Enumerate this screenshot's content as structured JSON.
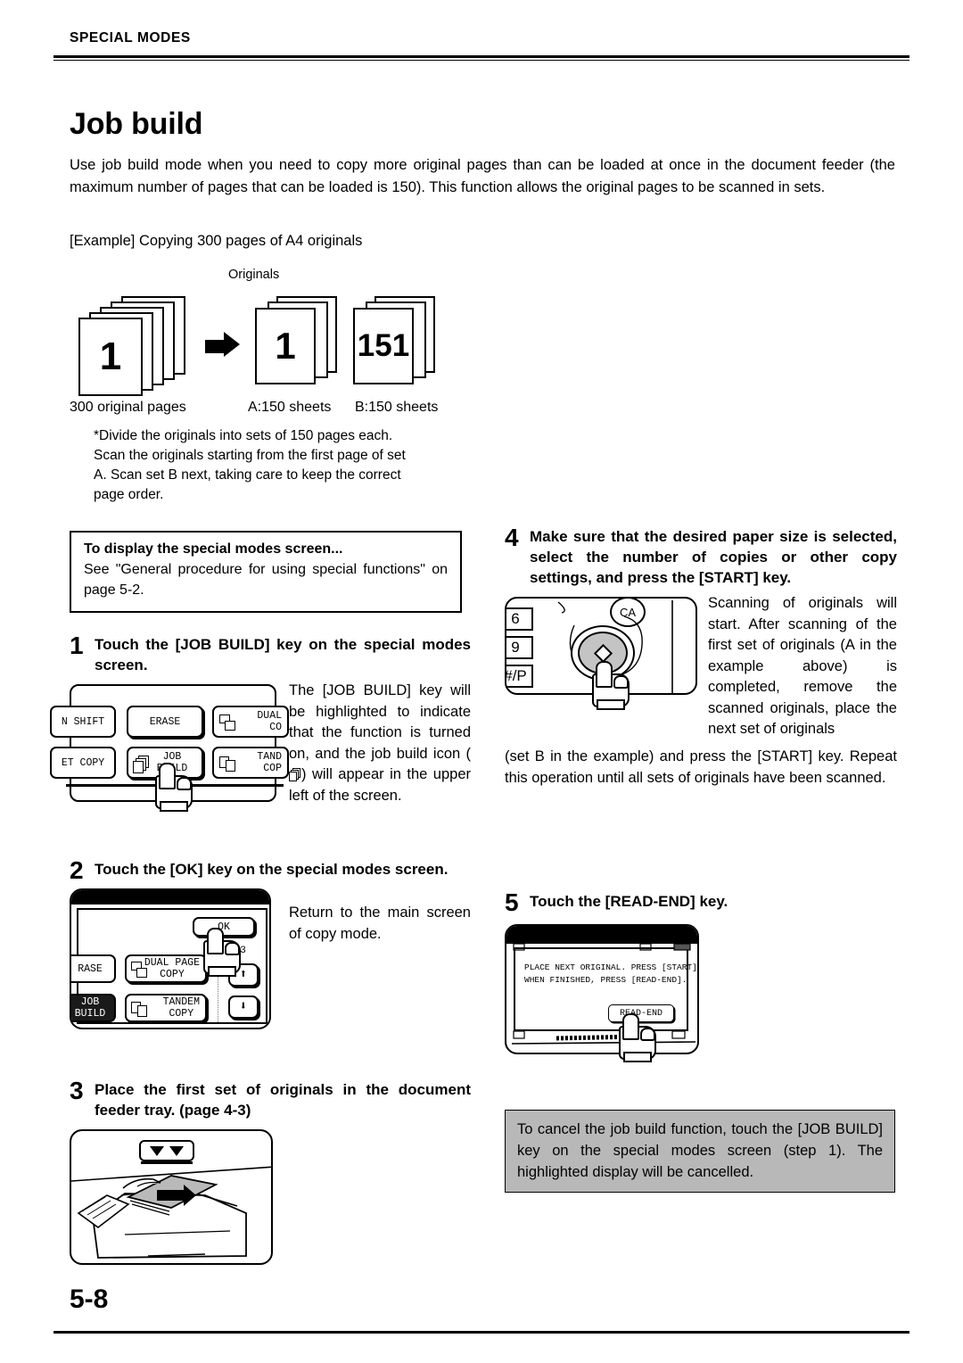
{
  "header": {
    "running_head": "SPECIAL MODES"
  },
  "title": "Job build",
  "intro": {
    "paragraph": "Use job build mode when you need to copy more original pages than can be loaded at once in the document feeder (the maximum number of pages that can be loaded is 150). This function allows the original pages to be scanned in sets.",
    "example_line": "[Example] Copying 300 pages of A4 originals"
  },
  "diagram": {
    "originals_label": "Originals",
    "source_number": "1",
    "set_a_number": "1",
    "set_b_number": "151",
    "caption_source": "300 original pages",
    "caption_a": "A:150 sheets",
    "caption_b": "B:150 sheets",
    "footnote_lines": [
      "*Divide the originals into sets of 150 pages each.",
      "Scan the originals starting from the first page of set",
      "A. Scan set B next, taking care to keep the correct",
      "page order."
    ]
  },
  "note_box": {
    "title": "To display the special modes screen...",
    "body": "See \"General procedure for using special functions\" on page 5-2."
  },
  "steps": {
    "step1": {
      "number": "1",
      "title": "Touch the [JOB BUILD] key on the special modes screen.",
      "body_before_icon": "The [JOB BUILD] key will be highlighted to indicate that the function is turned on, and the job build icon (",
      "body_after_icon": ") will appear in the upper left of the screen.",
      "panel_keys": {
        "margin_shift": "N SHIFT",
        "erase": "ERASE",
        "dual_page_copy": "DUAL\nCO",
        "booklet_copy": "ET COPY",
        "job_build": "JOB\nBUILD",
        "tandem_copy": "TAND\nCOP"
      }
    },
    "step2": {
      "number": "2",
      "title": "Touch the [OK] key on the special modes screen.",
      "body": "Return to the main screen of copy mode.",
      "panel_keys": {
        "ok": "OK",
        "page_indicator": "1/3",
        "erase": "RASE",
        "dual_page_copy": "DUAL PAGE\nCOPY",
        "job_build": "JOB\nBUILD",
        "tandem_copy": "TANDEM\nCOPY",
        "up_arrow": "up-arrow",
        "down_arrow": "down-arrow"
      }
    },
    "step3": {
      "number": "3",
      "title": "Place the first set of originals in the document feeder tray. (page 4-3)"
    },
    "step4": {
      "number": "4",
      "title": "Make sure that the desired paper size is selected, select the number of copies or other copy settings, and press the [START] key.",
      "body_right": "Scanning of originals will start. After scanning of the first set of originals (A in the example above) is completed, remove the scanned originals, place the next set of originals",
      "body_full": "(set B in the example) and press the [START] key. Repeat this operation until all sets of originals have been scanned.",
      "keys": {
        "key_6": "6",
        "key_9": "9",
        "key_hash_p": "#/P",
        "clear_all": "CA"
      }
    },
    "step5": {
      "number": "5",
      "title": "Touch the [READ-END] key.",
      "lcd_line1": "PLACE NEXT ORIGINAL. PRESS [START].",
      "lcd_line2": "WHEN FINISHED, PRESS [READ-END].",
      "lcd_button": "READ-END"
    }
  },
  "cancel_note": "To cancel the job build function, touch the [JOB BUILD] key on the special modes screen (step 1). The highlighted display will be cancelled.",
  "footer": {
    "page_number": "5-8"
  }
}
